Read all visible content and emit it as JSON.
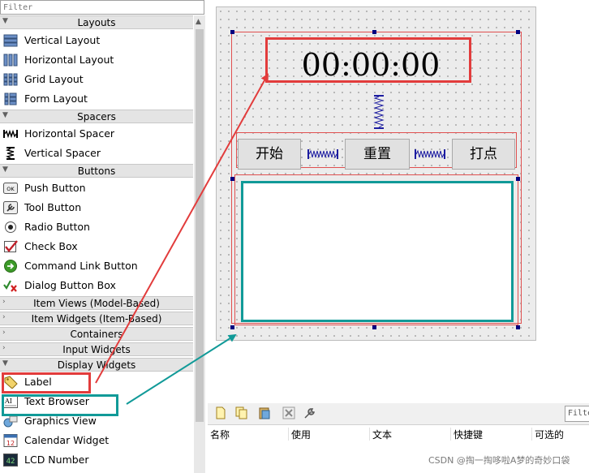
{
  "filter": {
    "placeholder": "Filter"
  },
  "categories": {
    "layouts": "Layouts",
    "spacers": "Spacers",
    "buttons": "Buttons",
    "item_views": "Item Views (Model-Based)",
    "item_widgets": "Item Widgets (Item-Based)",
    "containers": "Containers",
    "input_widgets": "Input Widgets",
    "display_widgets": "Display Widgets"
  },
  "widgets": {
    "vertical_layout": "Vertical Layout",
    "horizontal_layout": "Horizontal Layout",
    "grid_layout": "Grid Layout",
    "form_layout": "Form Layout",
    "horizontal_spacer": "Horizontal Spacer",
    "vertical_spacer": "Vertical Spacer",
    "push_button": "Push Button",
    "tool_button": "Tool Button",
    "radio_button": "Radio Button",
    "check_box": "Check Box",
    "command_link_button": "Command Link Button",
    "dialog_button_box": "Dialog Button Box",
    "label": "Label",
    "text_browser": "Text Browser",
    "graphics_view": "Graphics View",
    "calendar_widget": "Calendar Widget",
    "lcd_number": "LCD Number"
  },
  "form": {
    "time_display": "00:00:00",
    "start_button": "开始",
    "reset_button": "重置",
    "mark_button": "打点"
  },
  "bottom": {
    "filter_text": "Filte",
    "columns": [
      "名称",
      "使用",
      "文本",
      "快捷键",
      "可选的"
    ]
  },
  "watermark": "CSDN @掏一掏哆啦A梦的奇妙口袋",
  "colors": {
    "highlight_red": "#e23c3c",
    "highlight_teal": "#119a98",
    "layout_line": "#e05050",
    "selection_handle": "#000080"
  }
}
